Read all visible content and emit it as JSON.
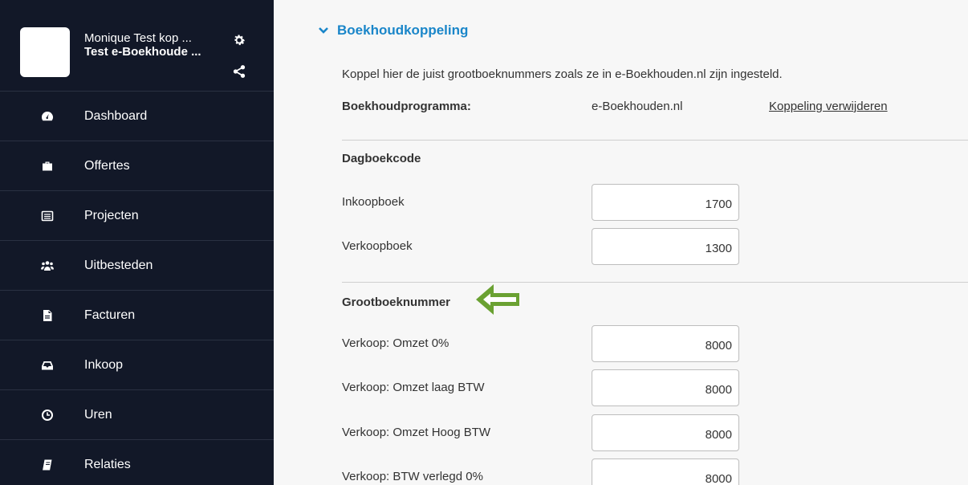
{
  "profile": {
    "name": "Monique Test kop ...",
    "company": "Test e-Boekhoude ..."
  },
  "nav": [
    {
      "label": "Dashboard",
      "icon": "dashboard-icon"
    },
    {
      "label": "Offertes",
      "icon": "briefcase-icon"
    },
    {
      "label": "Projecten",
      "icon": "list-icon"
    },
    {
      "label": "Uitbesteden",
      "icon": "users-icon"
    },
    {
      "label": "Facturen",
      "icon": "document-icon"
    },
    {
      "label": "Inkoop",
      "icon": "inbox-icon"
    },
    {
      "label": "Uren",
      "icon": "clock-icon"
    },
    {
      "label": "Relaties",
      "icon": "address-book-icon"
    }
  ],
  "section": {
    "title": "Boekhoudkoppeling",
    "intro": "Koppel hier de juist grootboeknummers zoals ze in e-Boekhouden.nl zijn ingesteld.",
    "program_label": "Boekhoudprogramma:",
    "program_value": "e-Boekhouden.nl",
    "remove_link": "Koppeling verwijderen"
  },
  "dagboek": {
    "heading": "Dagboekcode",
    "rows": [
      {
        "label": "Inkoopboek",
        "value": "1700"
      },
      {
        "label": "Verkoopboek",
        "value": "1300"
      }
    ]
  },
  "grootboek": {
    "heading": "Grootboeknummer",
    "rows": [
      {
        "label": "Verkoop: Omzet 0%",
        "value": "8000"
      },
      {
        "label": "Verkoop: Omzet laag BTW",
        "value": "8000"
      },
      {
        "label": "Verkoop: Omzet Hoog BTW",
        "value": "8000"
      },
      {
        "label": "Verkoop: BTW verlegd 0%",
        "value": "8000"
      }
    ]
  },
  "colors": {
    "sidebar": "#121828",
    "accent": "#1a86c9",
    "arrow": "#6aa132"
  }
}
